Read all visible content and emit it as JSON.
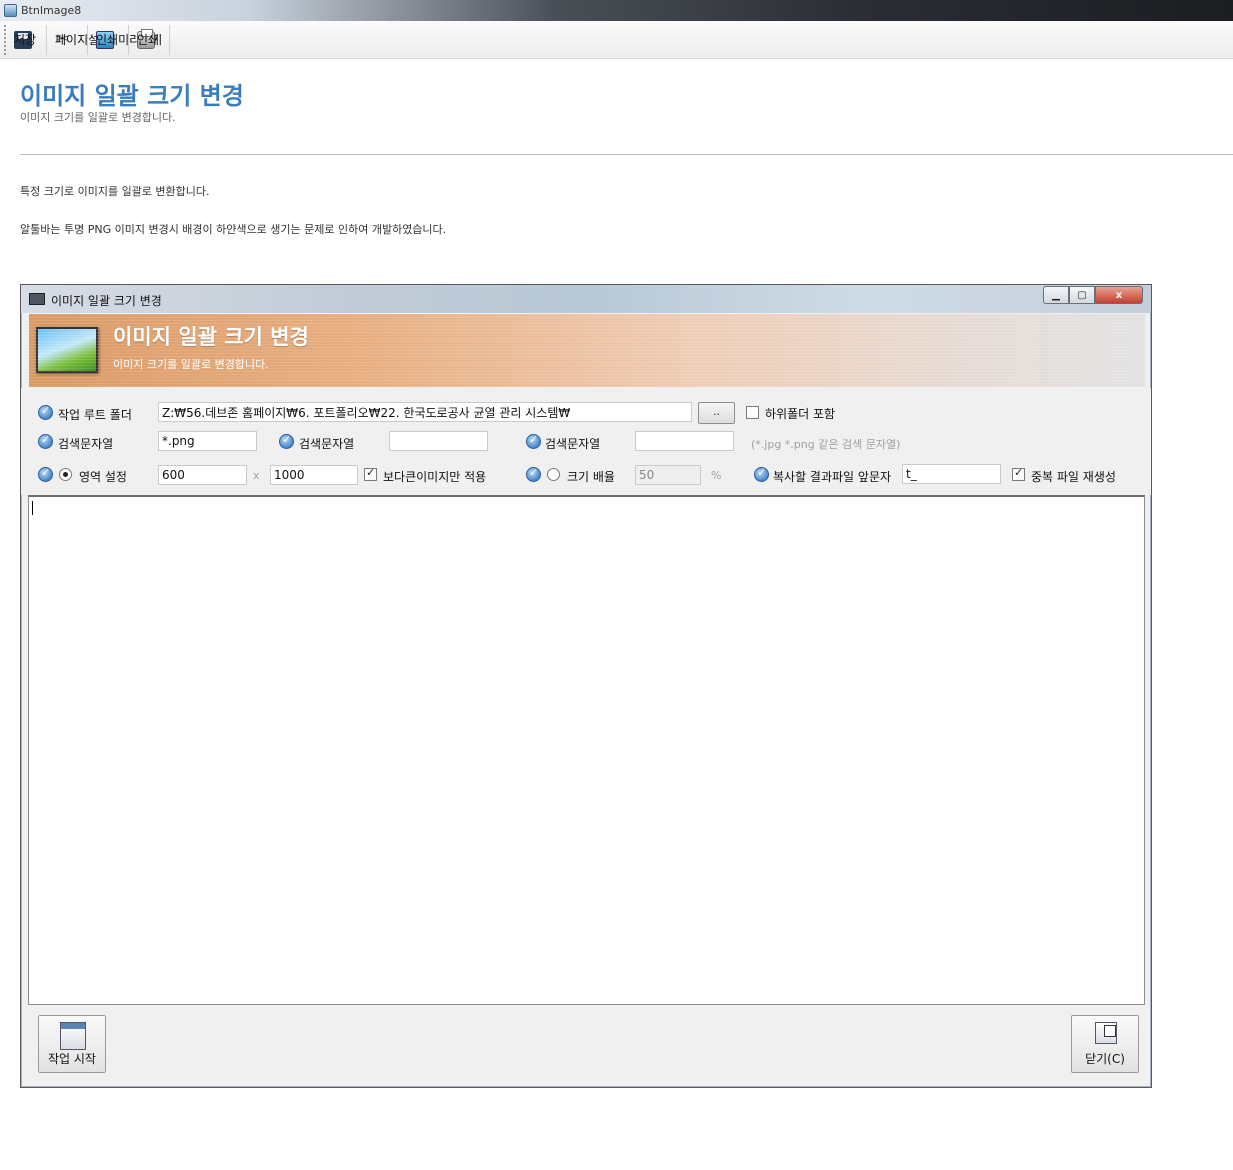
{
  "app": {
    "window_title": "BtnImage8"
  },
  "toolbar": {
    "save": "저장",
    "page_setup": "페이지설정",
    "print_preview": "인쇄미리보기",
    "print": "인쇄"
  },
  "page": {
    "title": "이미지 일괄 크기 변경",
    "subtitle": "이미지 크기를 일괄로 변경합니다.",
    "description_1": "특정 크기로 이미지를 일괄로 변환합니다.",
    "description_2": "알툴바는 투명 PNG 이미지 변경시 배경이 하얀색으로 생기는 문제로 인하여 개발하였습니다."
  },
  "dialog": {
    "window_title": "이미지 일괄 크기 변경",
    "close_glyph": "x",
    "banner_title": "이미지 일괄 크기 변경",
    "banner_subtitle": "이미지 크기를 일괄로 변경합니다.",
    "root_folder_label": "작업 루트 폴더",
    "root_folder_value": "Z:₩56.데브존 홈페이지₩6. 포트폴리오₩22. 한국도로공사 균열 관리 시스템₩",
    "browse_label": "..",
    "subfolder_label": "하위폴더 포함",
    "search1_label": "검색문자열",
    "search1_value": "*.png",
    "search2_label": "검색문자열",
    "search2_value": "",
    "search3_label": "검색문자열",
    "search3_value": "",
    "search_hint": "(*.jpg *.png 같은 검색 문자열)",
    "area_label": "영역 설정",
    "width_value": "600",
    "x_label": "x",
    "height_value": "1000",
    "larger_only_label": "보다큰이미지만 적용",
    "scale_label": "크기 배율",
    "scale_value": "50",
    "percent_label": "%",
    "prefix_label": "복사할 결과파일 앞문자",
    "prefix_value": "t_",
    "regenerate_label": "중복 파일 재생성",
    "start_button": "작업 시작",
    "close_button": "닫기(C)"
  },
  "state": {
    "subfolder_checked": false,
    "larger_only_checked": true,
    "regenerate_checked": true,
    "area_radio_selected": true,
    "scale_radio_selected": false
  },
  "colors": {
    "page_title": "#3a7dbd",
    "banner_start": "#d99a65",
    "banner_end": "#e2e2e2"
  }
}
